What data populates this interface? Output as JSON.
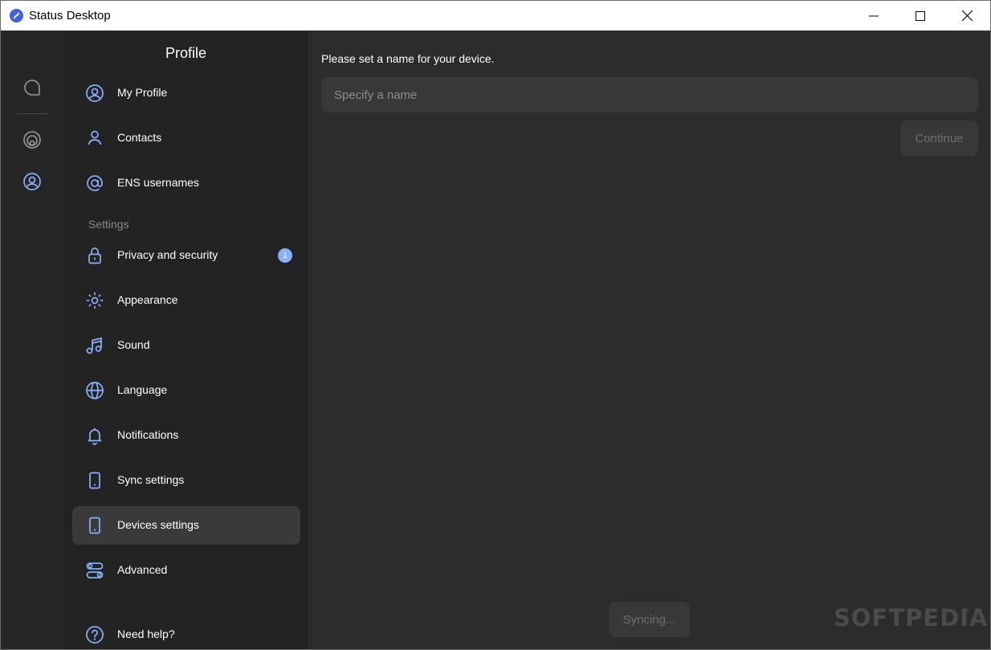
{
  "window": {
    "title": "Status Desktop"
  },
  "rail": {
    "items": [
      {
        "icon": "chat-icon"
      },
      {
        "icon": "communities-icon"
      },
      {
        "icon": "profile-icon"
      }
    ]
  },
  "sidebar": {
    "title": "Profile",
    "section_label": "Settings",
    "items": [
      {
        "label": "My Profile",
        "icon": "profile-circle-icon"
      },
      {
        "label": "Contacts",
        "icon": "contacts-icon"
      },
      {
        "label": "ENS usernames",
        "icon": "at-sign-icon"
      },
      {
        "label": "Privacy and security",
        "icon": "lock-icon",
        "badge": "1"
      },
      {
        "label": "Appearance",
        "icon": "sun-icon"
      },
      {
        "label": "Sound",
        "icon": "music-note-icon"
      },
      {
        "label": "Language",
        "icon": "globe-icon"
      },
      {
        "label": "Notifications",
        "icon": "bell-icon"
      },
      {
        "label": "Sync settings",
        "icon": "phone-icon"
      },
      {
        "label": "Devices settings",
        "icon": "phone-icon",
        "active": true
      },
      {
        "label": "Advanced",
        "icon": "toggles-icon"
      },
      {
        "label": "Need help?",
        "icon": "help-icon"
      }
    ]
  },
  "main": {
    "prompt": "Please set a name for your device.",
    "name_input": {
      "value": "",
      "placeholder": "Specify a name"
    },
    "continue_label": "Continue",
    "syncing_label": "Syncing..."
  },
  "watermark": {
    "text": "SOFTPEDIA",
    "reg": "®"
  },
  "colors": {
    "accent": "#4360df",
    "icon_blue": "#88b0ff",
    "background": "#2c2c2c",
    "sidebar": "#232323",
    "active_item": "#3a3a3a"
  }
}
